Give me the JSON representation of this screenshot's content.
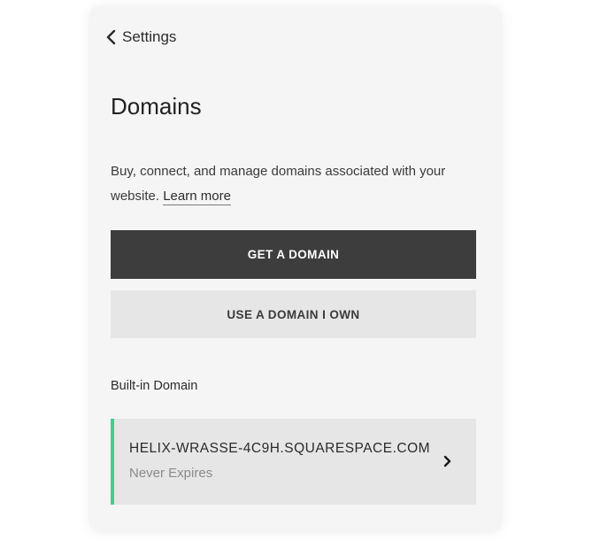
{
  "header": {
    "back_label": "Settings",
    "back_icon": "chevron-left-icon"
  },
  "page": {
    "title": "Domains",
    "description": "Buy, connect, and manage domains associated with your website.",
    "learn_more": "Learn more"
  },
  "actions": {
    "get_domain": "GET A DOMAIN",
    "use_own_domain": "USE A DOMAIN I OWN"
  },
  "builtin": {
    "section_label": "Built-in Domain",
    "domain": "HELIX-WRASSE-4C9H.SQUARESPACE.COM",
    "status": "Never Expires",
    "chevron_icon": "chevron-right-icon"
  },
  "colors": {
    "panel_bg": "#f5f5f5",
    "primary_button": "#3d3d3d",
    "secondary_button": "#e6e6e6",
    "accent": "#3ecf8e"
  }
}
